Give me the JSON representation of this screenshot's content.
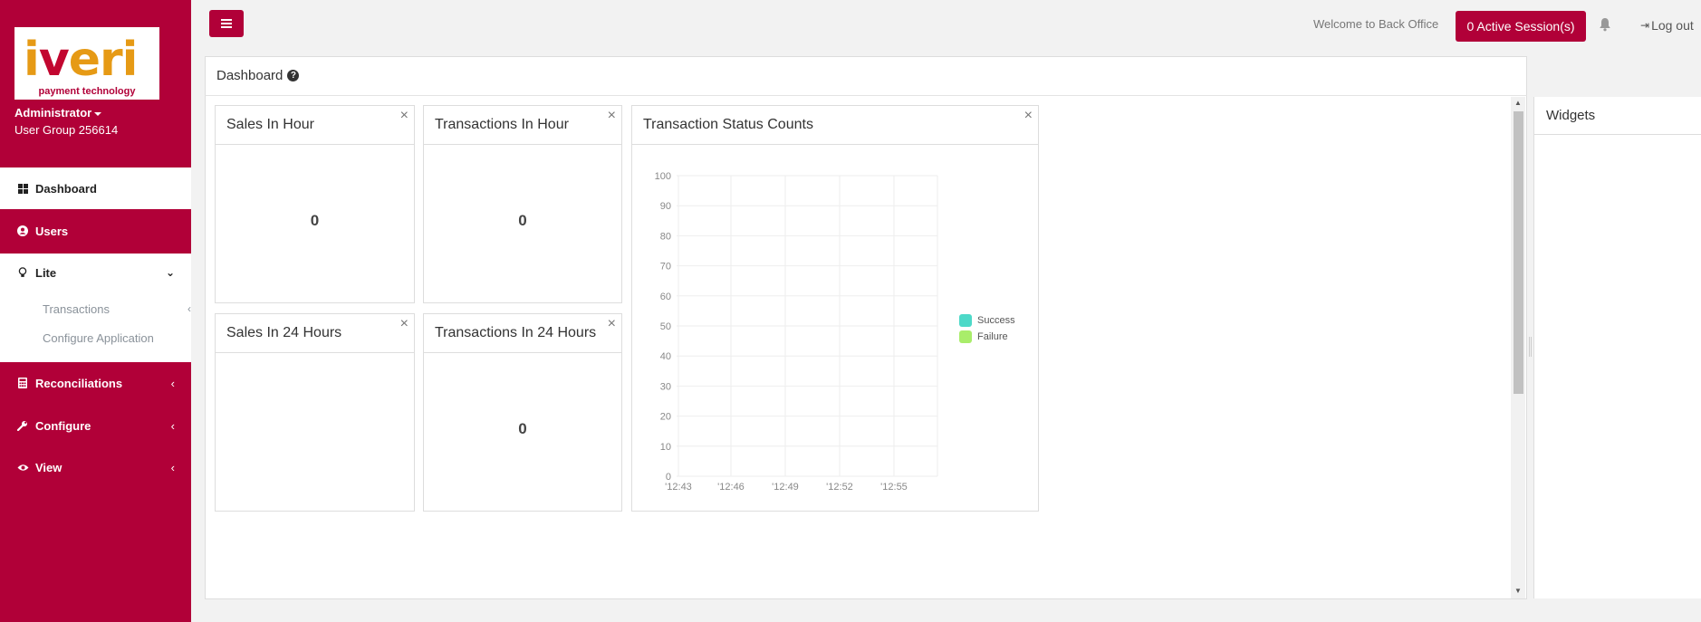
{
  "brand": {
    "logo_primary": "iveri",
    "logo_tagline": "payment technology",
    "accent_color": "#b10038"
  },
  "user": {
    "name": "Administrator",
    "group": "User Group 256614"
  },
  "sidebar": {
    "items": [
      {
        "label": "Dashboard",
        "icon": "dashboard-grid-icon",
        "active": true
      },
      {
        "label": "Users",
        "icon": "user-circle-icon"
      },
      {
        "label": "Lite",
        "icon": "lightbulb-icon",
        "expanded": true,
        "children": [
          {
            "label": "Transactions"
          },
          {
            "label": "Configure Application"
          }
        ]
      },
      {
        "label": "Reconciliations",
        "icon": "calculator-icon"
      },
      {
        "label": "Configure",
        "icon": "wrench-icon"
      },
      {
        "label": "View",
        "icon": "eye-icon"
      }
    ]
  },
  "topbar": {
    "welcome": "Welcome to Back Office",
    "sessions_label": "0 Active Session(s)",
    "logout_label": "Log out"
  },
  "dashboard": {
    "title": "Dashboard",
    "widgets": [
      {
        "title": "Sales In Hour",
        "value": "0"
      },
      {
        "title": "Transactions In Hour",
        "value": "0"
      },
      {
        "title": "Sales In 24 Hours",
        "value": ""
      },
      {
        "title": "Transactions In 24 Hours",
        "value": "0"
      },
      {
        "title": "Transaction Status Counts"
      }
    ]
  },
  "side_panel": {
    "title": "Widgets"
  },
  "chart_data": {
    "type": "line",
    "title": "Transaction Status Counts",
    "x": [
      "'12:43",
      "'12:46",
      "'12:49",
      "'12:52",
      "'12:55"
    ],
    "xlabel": "",
    "ylabel": "",
    "ylim": [
      0,
      100
    ],
    "yticks": [
      0,
      10,
      20,
      30,
      40,
      50,
      60,
      70,
      80,
      90,
      100
    ],
    "grid": true,
    "legend_position": "right",
    "series": [
      {
        "name": "Success",
        "color": "#4dd9c8",
        "values": [
          0,
          0,
          0,
          0,
          0
        ]
      },
      {
        "name": "Failure",
        "color": "#a9ed6a",
        "values": [
          0,
          0,
          0,
          0,
          0
        ]
      }
    ]
  }
}
